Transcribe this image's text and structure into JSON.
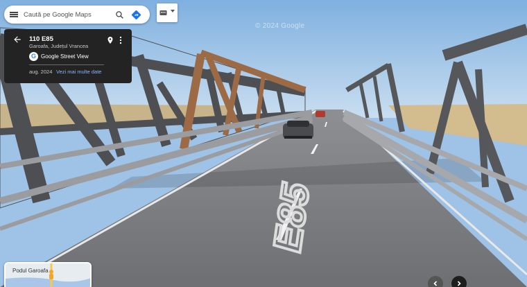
{
  "search": {
    "placeholder": "Caută pe Google Maps",
    "search_icon": "search-icon",
    "directions_icon": "directions-icon",
    "menu_icon": "hamburger-menu-icon"
  },
  "layers": {
    "icon": "keyboard-layer-icon",
    "dropdown_icon": "caret-down-icon"
  },
  "info_card": {
    "title": "110 E85",
    "location": "Garoafa, Județul Vrancea",
    "source": "Google Street View",
    "date": "aug. 2024",
    "more_dates_link": "Vezi mai multe date",
    "back_icon": "arrow-left-icon",
    "pin_icon": "location-pin-icon",
    "more_icon": "more-vertical-icon"
  },
  "watermark": "© 2024 Google",
  "road_marking": "E85",
  "minimap": {
    "label": "Podul Garoafa",
    "pegman_icon": "pegman-icon"
  },
  "navigation": {
    "prev_icon": "chevron-left-icon",
    "next_icon": "chevron-right-icon"
  },
  "colors": {
    "sky": "#9ec3e6",
    "card_bg": "#232323",
    "link": "#8ab4f8",
    "bridge_steel": "#4e4f52"
  }
}
